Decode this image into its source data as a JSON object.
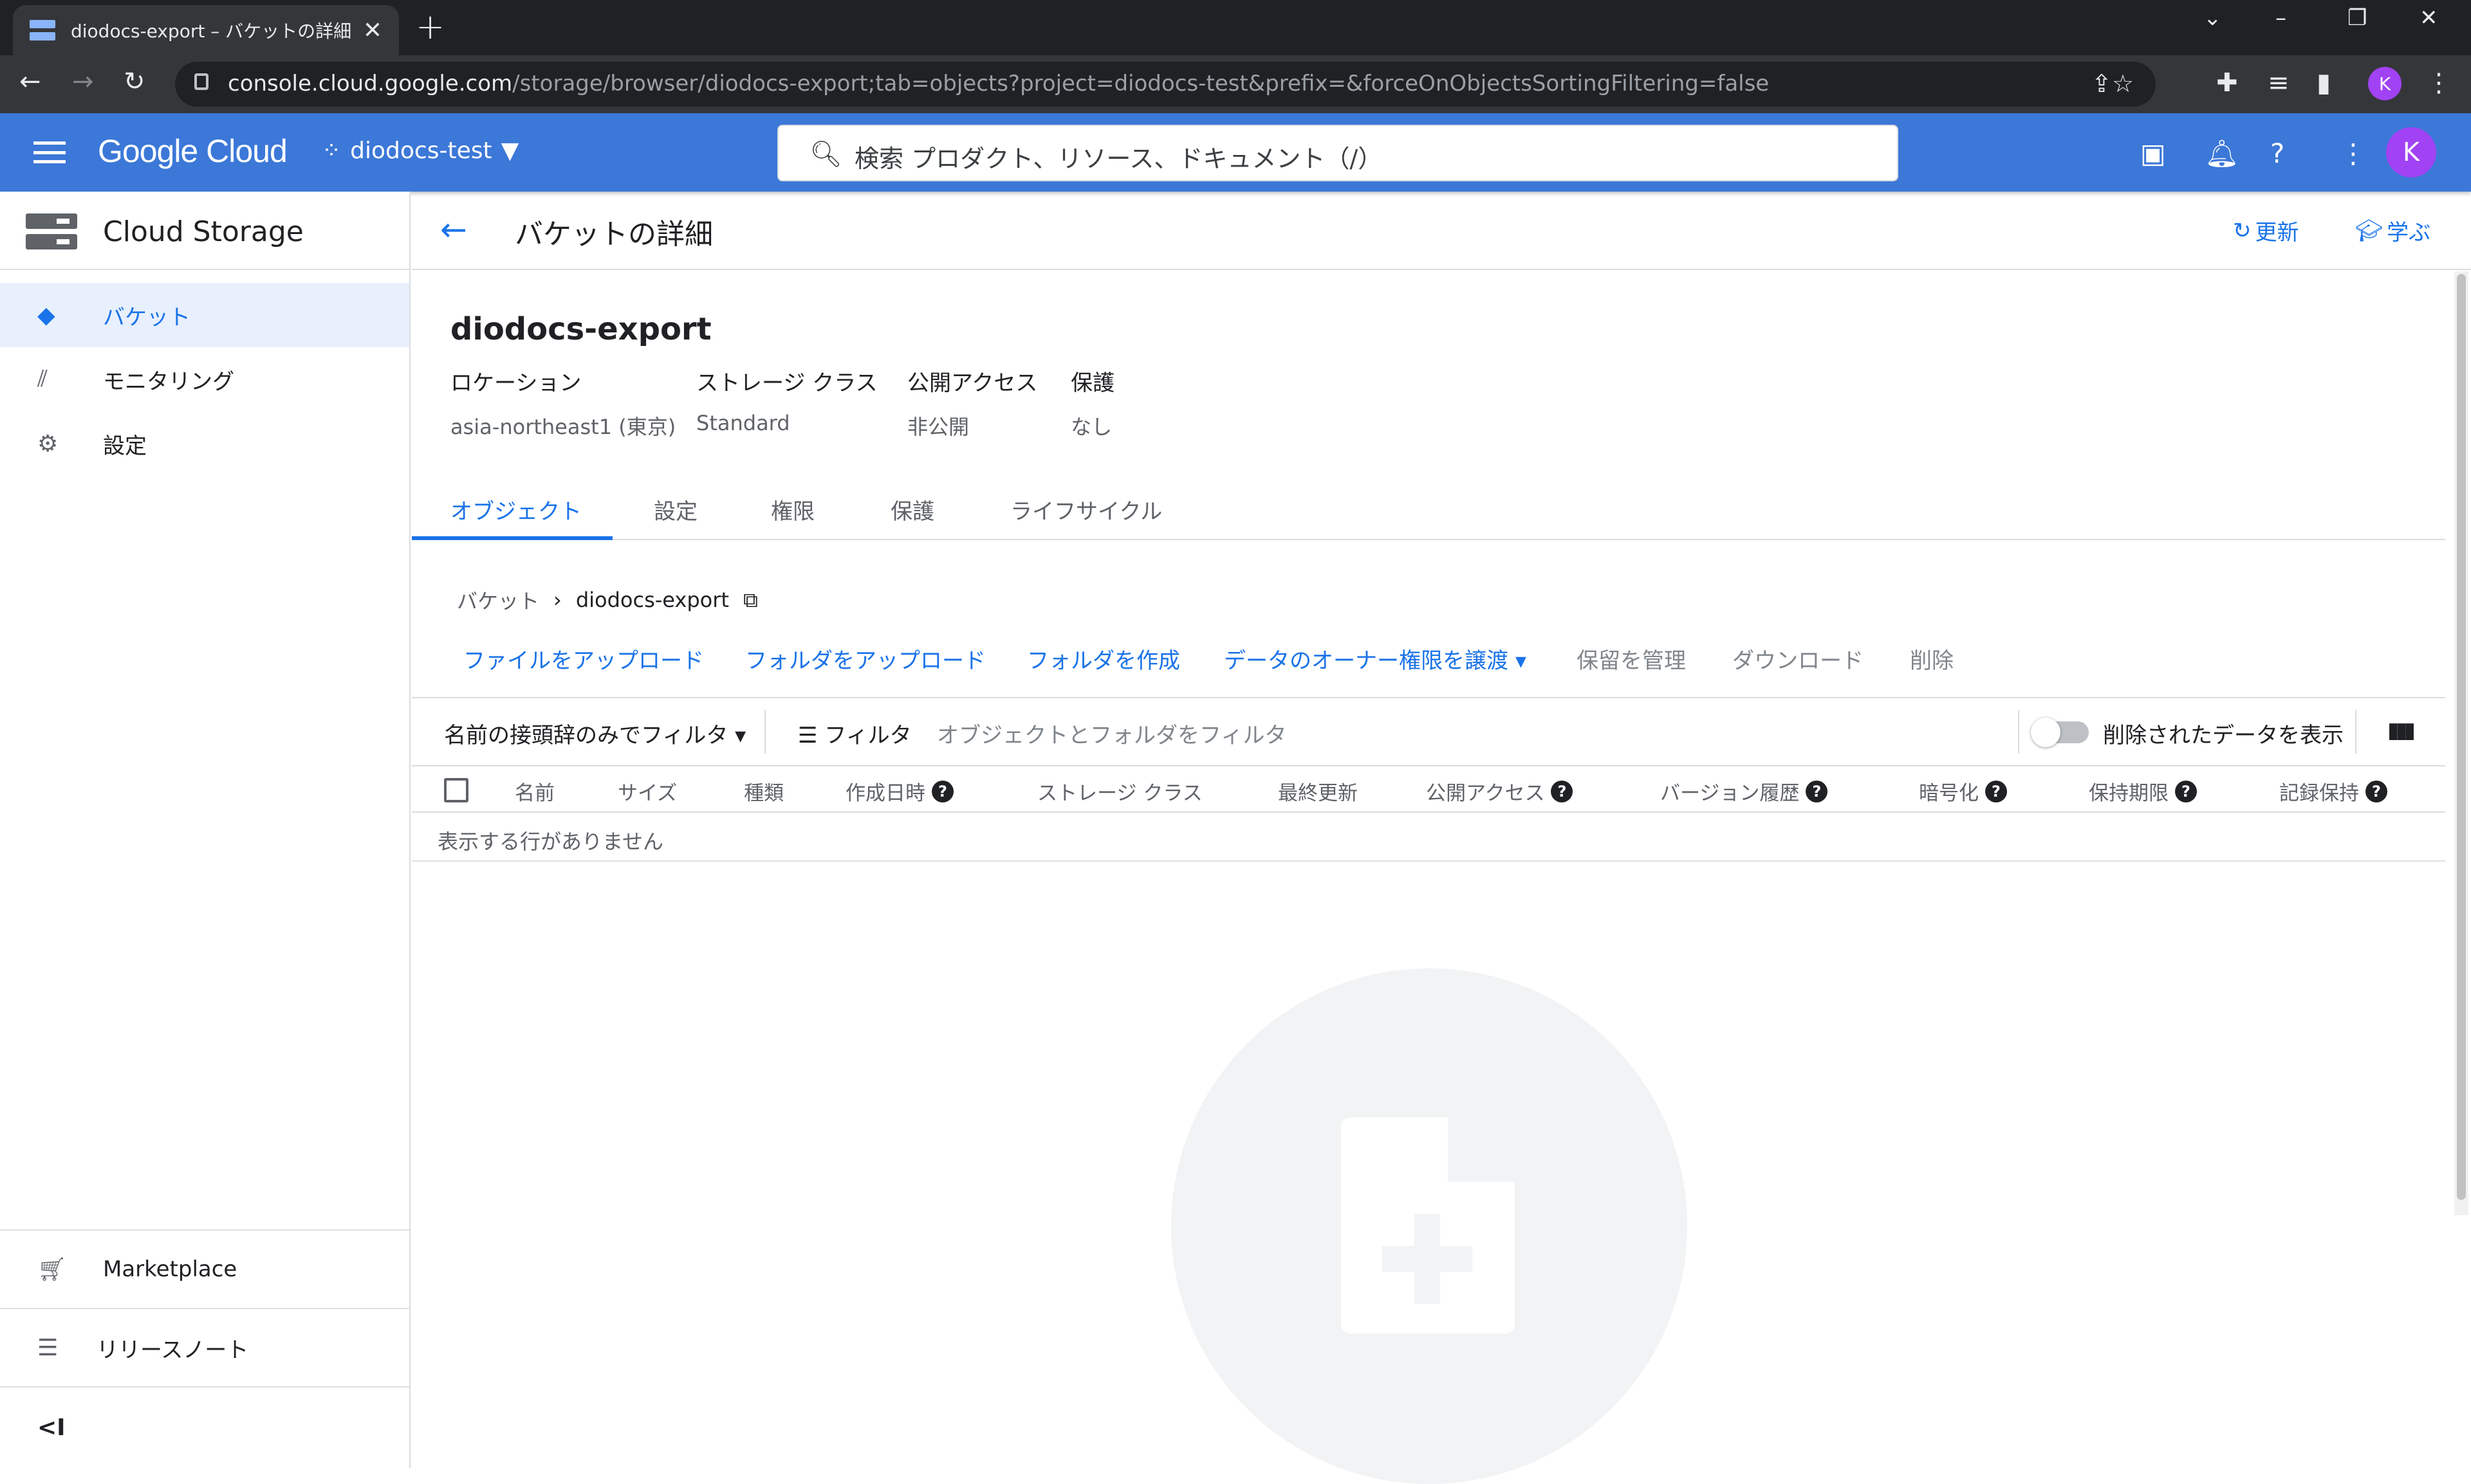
{
  "browser": {
    "tab_title": "diodocs-export – バケットの詳細 –",
    "new_tab": "+",
    "url_host": "console.cloud.google.com",
    "url_path": "/storage/browser/diodocs-export;tab=objects?project=diodocs-test&prefix=&forceOnObjectsSortingFiltering=false",
    "profile_initial": "K"
  },
  "header": {
    "logo": "Google Cloud",
    "project": "diodocs-test",
    "search_placeholder": "検索  プロダクト、リソース、ドキュメント（/）",
    "avatar_initial": "K"
  },
  "sidebar": {
    "product": "Cloud Storage",
    "items": [
      {
        "label": "バケット",
        "icon": "bucket-icon"
      },
      {
        "label": "モニタリング",
        "icon": "monitoring-icon"
      },
      {
        "label": "設定",
        "icon": "gear-icon"
      }
    ],
    "footer": [
      {
        "label": "Marketplace",
        "icon": "cart-icon"
      },
      {
        "label": "リリースノート",
        "icon": "notes-icon"
      }
    ],
    "collapse": "<I"
  },
  "page": {
    "title": "バケットの詳細",
    "refresh": "更新",
    "learn": "学ぶ",
    "bucket_name": "diodocs-export",
    "meta": [
      {
        "key": "ロケーション",
        "value": "asia-northeast1 (東京)"
      },
      {
        "key": "ストレージ クラス",
        "value": "Standard"
      },
      {
        "key": "公開アクセス",
        "value": "非公開"
      },
      {
        "key": "保護",
        "value": "なし"
      }
    ],
    "tabs": [
      "オブジェクト",
      "設定",
      "権限",
      "保護",
      "ライフサイクル"
    ],
    "breadcrumb": {
      "root": "バケット",
      "current": "diodocs-export"
    },
    "actions": {
      "upload_files": "ファイルをアップロード",
      "upload_folder": "フォルダをアップロード",
      "create_folder": "フォルダを作成",
      "transfer_ownership": "データのオーナー権限を譲渡",
      "manage_holds": "保留を管理",
      "download": "ダウンロード",
      "delete": "削除"
    },
    "filter": {
      "prefix_filter": "名前の接頭辞のみでフィルタ",
      "filter_label": "フィルタ",
      "filter_placeholder": "オブジェクトとフォルダをフィルタ",
      "show_deleted": "削除されたデータを表示"
    },
    "columns": [
      "名前",
      "サイズ",
      "種類",
      "作成日時",
      "ストレージ クラス",
      "最終更新",
      "公開アクセス",
      "バージョン履歴",
      "暗号化",
      "保持期限",
      "記録保持"
    ],
    "empty_text": "表示する行がありません"
  }
}
